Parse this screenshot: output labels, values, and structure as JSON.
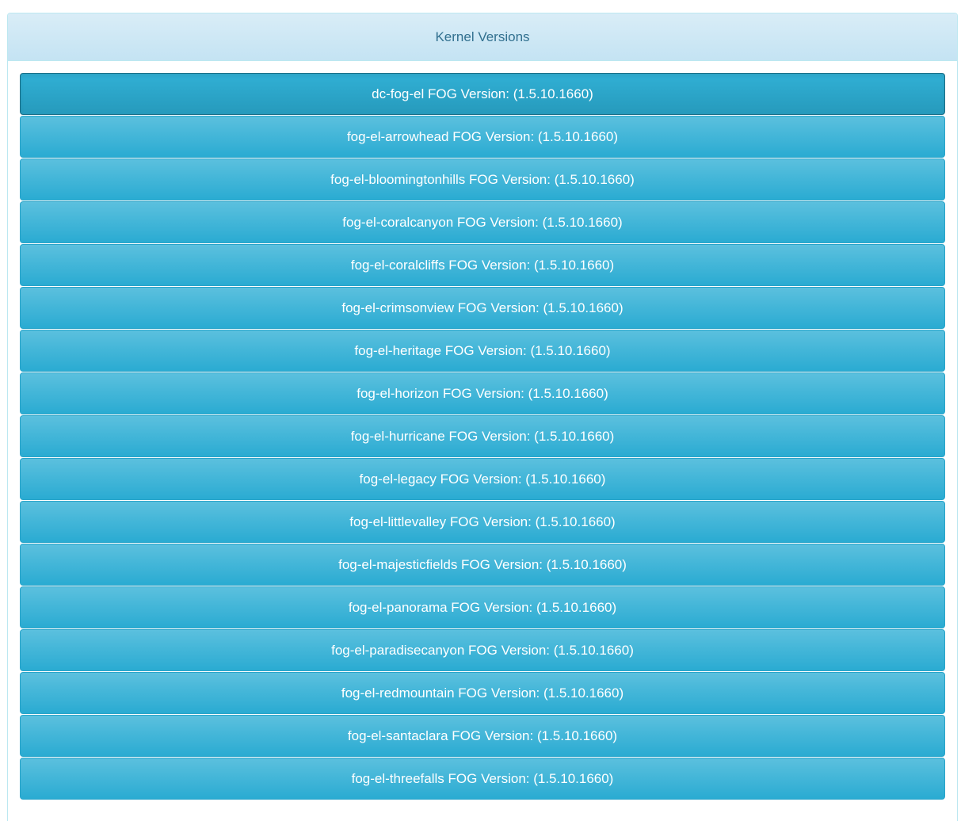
{
  "panel": {
    "title": "Kernel Versions"
  },
  "versions": [
    {
      "label": "dc-fog-el FOG Version: (1.5.10.1660)",
      "active": true
    },
    {
      "label": "fog-el-arrowhead FOG Version: (1.5.10.1660)"
    },
    {
      "label": "fog-el-bloomingtonhills FOG Version: (1.5.10.1660)"
    },
    {
      "label": "fog-el-coralcanyon FOG Version: (1.5.10.1660)"
    },
    {
      "label": "fog-el-coralcliffs FOG Version: (1.5.10.1660)"
    },
    {
      "label": "fog-el-crimsonview FOG Version: (1.5.10.1660)"
    },
    {
      "label": "fog-el-heritage FOG Version: (1.5.10.1660)"
    },
    {
      "label": "fog-el-horizon FOG Version: (1.5.10.1660)"
    },
    {
      "label": "fog-el-hurricane FOG Version: (1.5.10.1660)"
    },
    {
      "label": "fog-el-legacy FOG Version: (1.5.10.1660)"
    },
    {
      "label": "fog-el-littlevalley FOG Version: (1.5.10.1660)"
    },
    {
      "label": "fog-el-majesticfields FOG Version: (1.5.10.1660)"
    },
    {
      "label": "fog-el-panorama FOG Version: (1.5.10.1660)"
    },
    {
      "label": "fog-el-paradisecanyon FOG Version: (1.5.10.1660)"
    },
    {
      "label": "fog-el-redmountain FOG Version: (1.5.10.1660)"
    },
    {
      "label": "fog-el-santaclara FOG Version: (1.5.10.1660)"
    },
    {
      "label": "fog-el-threefalls FOG Version: (1.5.10.1660)"
    }
  ],
  "colors": {
    "heading_bg": "#d9edf7",
    "heading_text": "#31708f",
    "button_bg": "#5bc0de",
    "button_active_bg": "#31b0d5",
    "button_text": "#ffffff"
  }
}
